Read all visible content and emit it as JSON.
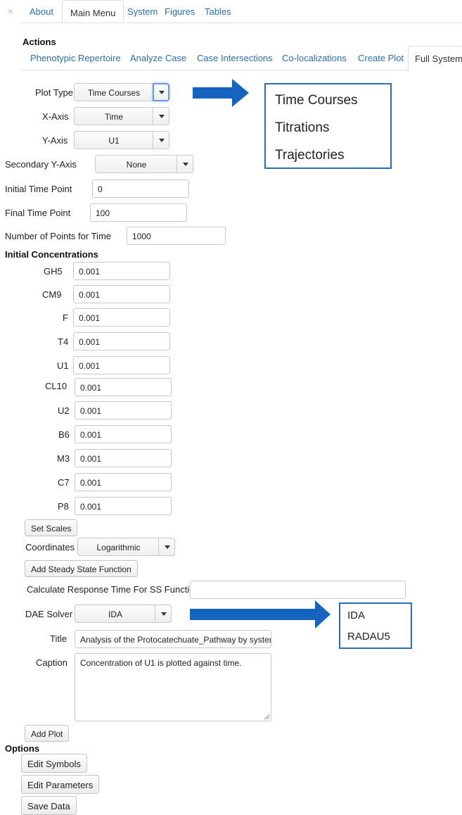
{
  "close_symbol": "×",
  "tabs": [
    {
      "label": "About"
    },
    {
      "label": "Main Menu"
    },
    {
      "label": "System"
    },
    {
      "label": "Figures"
    },
    {
      "label": "Tables"
    }
  ],
  "actions_title": "Actions",
  "subtabs": [
    {
      "label": "Phenotypic Repertoire"
    },
    {
      "label": "Analyze Case"
    },
    {
      "label": "Case Intersections"
    },
    {
      "label": "Co-localizations"
    },
    {
      "label": "Create Plot"
    },
    {
      "label": "Full System"
    }
  ],
  "form": {
    "plot_type": {
      "label": "Plot Type",
      "value": "Time Courses"
    },
    "x_axis": {
      "label": "X-Axis",
      "value": "Time"
    },
    "y_axis": {
      "label": "Y-Axis",
      "value": "U1"
    },
    "secondary_y": {
      "label": "Secondary Y-Axis",
      "value": "None"
    },
    "initial_time": {
      "label": "Initial Time Point",
      "value": "0"
    },
    "final_time": {
      "label": "Final Time Point",
      "value": "100"
    },
    "num_points": {
      "label": "Number of Points for Time",
      "value": "1000"
    },
    "concentrations_title": "Initial Concentrations",
    "concentrations": [
      {
        "name": "GH5",
        "value": "0.001"
      },
      {
        "name": "CM9",
        "value": "0.001"
      },
      {
        "name": "F",
        "value": "0.001"
      },
      {
        "name": "T4",
        "value": "0.001"
      },
      {
        "name": "U1",
        "value": "0.001"
      },
      {
        "name": "CL10",
        "value": "0.001"
      },
      {
        "name": "U2",
        "value": "0.001"
      },
      {
        "name": "B6",
        "value": "0.001"
      },
      {
        "name": "M3",
        "value": "0.001"
      },
      {
        "name": "C7",
        "value": "0.001"
      },
      {
        "name": "P8",
        "value": "0.001"
      }
    ],
    "set_scales_label": "Set Scales",
    "coordinates": {
      "label": "Coordinates",
      "value": "Logarithmic"
    },
    "add_steady_state_label": "Add Steady State Function",
    "response_time": {
      "label": "Calculate Response Time For SS Function",
      "value": ""
    },
    "dae_solver": {
      "label": "DAE Solver",
      "value": "IDA"
    },
    "title": {
      "label": "Title",
      "value": "Analysis of the Protocatechuate_Pathway by system design"
    },
    "caption": {
      "label": "Caption",
      "value": "Concentration of U1 is plotted against time."
    },
    "add_plot_label": "Add Plot"
  },
  "plot_type_options": [
    "Time Courses",
    "Titrations",
    "Trajectories"
  ],
  "dae_solver_options": [
    "IDA",
    "RADAU5"
  ],
  "options_title": "Options",
  "options_buttons": [
    {
      "label": "Edit Symbols"
    },
    {
      "label": "Edit Parameters"
    },
    {
      "label": "Save Data"
    }
  ],
  "colors": {
    "link": "#2a6fb8",
    "callout": "#2a6bbf",
    "arrow": "#1565c0"
  }
}
